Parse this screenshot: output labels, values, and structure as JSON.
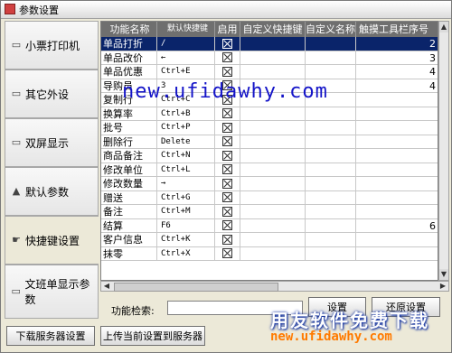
{
  "window": {
    "title": "参数设置"
  },
  "sidebar": {
    "items": [
      {
        "label": "小票打印机",
        "icon": "printer-icon"
      },
      {
        "label": "其它外设",
        "icon": "device-icon"
      },
      {
        "label": "双屏显示",
        "icon": "monitor-icon"
      },
      {
        "label": "默认参数",
        "icon": "params-icon"
      },
      {
        "label": "快捷键设置",
        "icon": "hand-icon",
        "active": true
      },
      {
        "label": "文班单显示参数",
        "icon": "display-icon"
      }
    ]
  },
  "grid": {
    "columns": [
      "功能名称",
      "默认快捷键",
      "启用",
      "自定义快捷键",
      "自定义名称",
      "触摸工具栏序号"
    ],
    "rows": [
      {
        "name": "单品打折",
        "key": "/",
        "order": "2",
        "selected": true
      },
      {
        "name": "单品改价",
        "key": "←",
        "order": "3"
      },
      {
        "name": "单品优惠",
        "key": "Ctrl+E",
        "order": "4"
      },
      {
        "name": "导购员",
        "key": "3",
        "order": "4"
      },
      {
        "name": "复制行",
        "key": "Ctrl+C",
        "order": ""
      },
      {
        "name": "换算率",
        "key": "Ctrl+B",
        "order": ""
      },
      {
        "name": "批号",
        "key": "Ctrl+P",
        "order": ""
      },
      {
        "name": "删除行",
        "key": "Delete",
        "order": ""
      },
      {
        "name": "商品备注",
        "key": "Ctrl+N",
        "order": ""
      },
      {
        "name": "修改单位",
        "key": "Ctrl+L",
        "order": ""
      },
      {
        "name": "修改数量",
        "key": "→",
        "order": ""
      },
      {
        "name": "赠送",
        "key": "Ctrl+G",
        "order": ""
      },
      {
        "name": "备注",
        "key": "Ctrl+M",
        "order": ""
      },
      {
        "name": "结算",
        "key": "F6",
        "order": "6"
      },
      {
        "name": "客户信息",
        "key": "Ctrl+K",
        "order": ""
      },
      {
        "name": "抹零",
        "key": "Ctrl+X",
        "order": ""
      }
    ]
  },
  "search": {
    "label": "功能检索:",
    "value": ""
  },
  "buttons": {
    "set": "设置",
    "restore": "还原设置",
    "download": "下载服务器设置",
    "upload": "上传当前设置到服务器"
  },
  "watermark": {
    "url": "new.ufidawhy.com",
    "brand": "用友软件免费下载",
    "footer_url": "new.ufidawhy.com"
  }
}
